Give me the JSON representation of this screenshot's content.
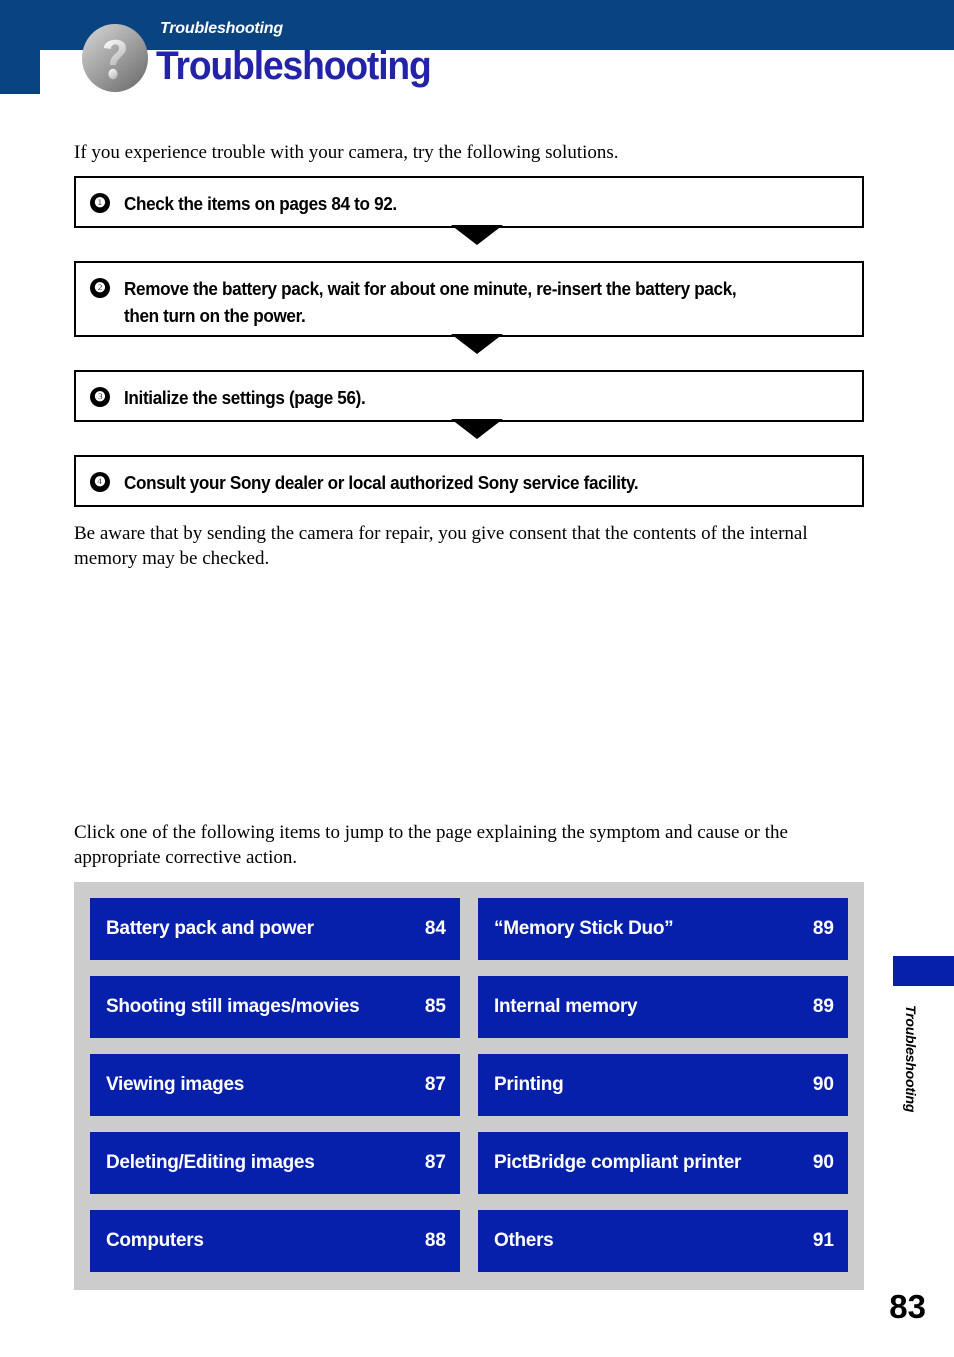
{
  "header": {
    "breadcrumb": "Troubleshooting",
    "title": "Troubleshooting",
    "band_color": "#0a4480",
    "title_color": "#2323a8",
    "icon": "question-mark-badge-icon"
  },
  "intro": {
    "text": "If you experience trouble with your camera, try the following solutions."
  },
  "steps": [
    {
      "number": "❶",
      "text": "Check the items on pages 84 to 92."
    },
    {
      "number": "❷",
      "text": "Remove the battery pack, wait for about one minute, re-insert the battery pack,\nthen turn on the power."
    },
    {
      "number": "❸",
      "text": "Initialize the settings (page 56)."
    },
    {
      "number": "❹",
      "text": "Consult your Sony dealer or local authorized Sony service facility."
    }
  ],
  "repair_note": {
    "text": "Be aware that by sending the camera for repair, you give consent that the contents of the internal memory may be checked."
  },
  "click_note": {
    "text": "Click one of the following items to jump to the page explaining the symptom and cause or the appropriate corrective action."
  },
  "link_panel": {
    "background_color": "#cccccc",
    "button_color": "#0720ab",
    "items": [
      {
        "label": "Battery pack and power",
        "page": "84"
      },
      {
        "label": "“Memory Stick Duo”",
        "page": "89"
      },
      {
        "label": "Shooting still images/movies",
        "page": "85"
      },
      {
        "label": "Internal memory",
        "page": "89"
      },
      {
        "label": "Viewing images",
        "page": "87"
      },
      {
        "label": "Printing",
        "page": "90"
      },
      {
        "label": "Deleting/Editing images",
        "page": "87"
      },
      {
        "label": "PictBridge compliant printer",
        "page": "90"
      },
      {
        "label": "Computers",
        "page": "88"
      },
      {
        "label": "Others",
        "page": "91"
      }
    ]
  },
  "side_tab": {
    "label": "Troubleshooting",
    "marker_color": "#0720ab"
  },
  "footer": {
    "page_number": "83"
  }
}
